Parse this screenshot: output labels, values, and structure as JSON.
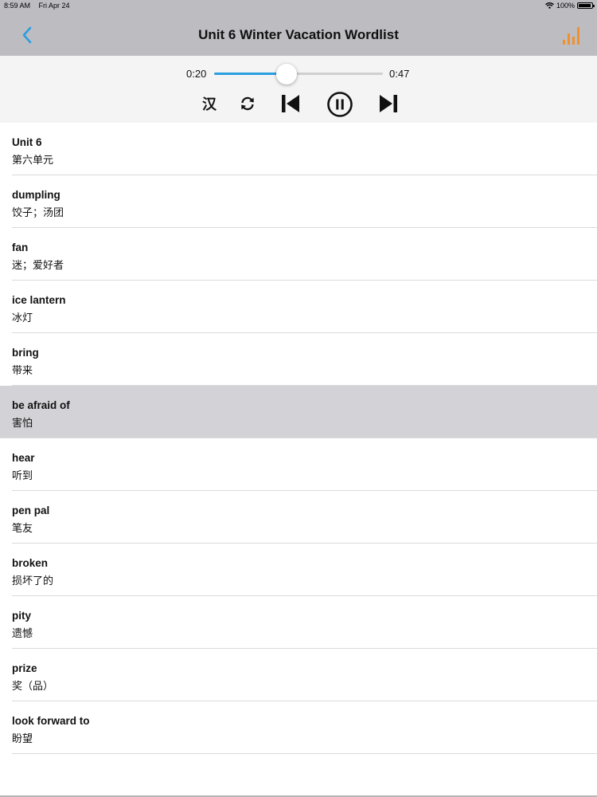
{
  "status_bar": {
    "time": "8:59 AM",
    "date": "Fri Apr 24",
    "battery": "100%",
    "battery_level": 1.0
  },
  "nav": {
    "title": "Unit 6 Winter Vacation Wordlist",
    "back_icon": "chevron-left-icon",
    "chart_icon": "bar-chart-icon",
    "accent_color": "#2a9fe0",
    "chart_color": "#f0912e"
  },
  "player": {
    "current_time": "0:20",
    "duration": "0:47",
    "progress": 0.43,
    "chinese_toggle": "汉",
    "controls": [
      "repeat-icon",
      "skip-previous-icon",
      "pause-icon",
      "skip-next-icon"
    ]
  },
  "words": [
    {
      "en": "Unit 6",
      "zh": "第六单元",
      "selected": false
    },
    {
      "en": "dumpling",
      "zh": "饺子；汤团",
      "selected": false
    },
    {
      "en": "fan",
      "zh": "迷；爱好者",
      "selected": false
    },
    {
      "en": "ice lantern",
      "zh": "冰灯",
      "selected": false
    },
    {
      "en": "bring",
      "zh": "带来",
      "selected": false
    },
    {
      "en": "be afraid of",
      "zh": "害怕",
      "selected": true
    },
    {
      "en": "hear",
      "zh": "听到",
      "selected": false
    },
    {
      "en": "pen pal",
      "zh": "笔友",
      "selected": false
    },
    {
      "en": "broken",
      "zh": "损坏了的",
      "selected": false
    },
    {
      "en": "pity",
      "zh": "遗憾",
      "selected": false
    },
    {
      "en": "prize",
      "zh": "奖（品）",
      "selected": false
    },
    {
      "en": "look forward to",
      "zh": "盼望",
      "selected": false
    }
  ]
}
